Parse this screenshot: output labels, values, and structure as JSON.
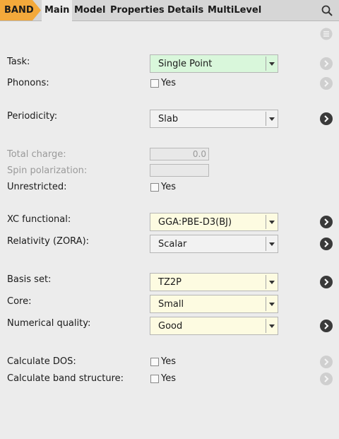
{
  "tabs": {
    "badge": "BAND",
    "items": [
      "Main",
      "Model",
      "Properties",
      "Details",
      "MultiLevel"
    ],
    "active": "Main"
  },
  "form": {
    "task": {
      "label": "Task:",
      "value": "Single Point"
    },
    "phonons": {
      "label": "Phonons:",
      "check": "Yes"
    },
    "periodicity": {
      "label": "Periodicity:",
      "value": "Slab"
    },
    "total_charge": {
      "label": "Total charge:",
      "value": "0.0"
    },
    "spin_polarization": {
      "label": "Spin polarization:",
      "value": ""
    },
    "unrestricted": {
      "label": "Unrestricted:",
      "check": "Yes"
    },
    "xc_functional": {
      "label": "XC functional:",
      "value": "GGA:PBE-D3(BJ)"
    },
    "relativity": {
      "label": "Relativity (ZORA):",
      "value": "Scalar"
    },
    "basis_set": {
      "label": "Basis set:",
      "value": "TZ2P"
    },
    "core": {
      "label": "Core:",
      "value": "Small"
    },
    "numerical_quality": {
      "label": "Numerical quality:",
      "value": "Good"
    },
    "calc_dos": {
      "label": "Calculate DOS:",
      "check": "Yes"
    },
    "calc_band": {
      "label": "Calculate band structure:",
      "check": "Yes"
    }
  },
  "colors": {
    "badge": "#f3a93b",
    "green_field": "#d9f7db",
    "yellow_field": "#fdfbe1",
    "go_dark": "#3a3a3a",
    "go_light": "#cfcfcf"
  },
  "icons": {
    "search": "search-icon",
    "menu": "menu-icon",
    "go": "arrow-right-circle-icon"
  }
}
